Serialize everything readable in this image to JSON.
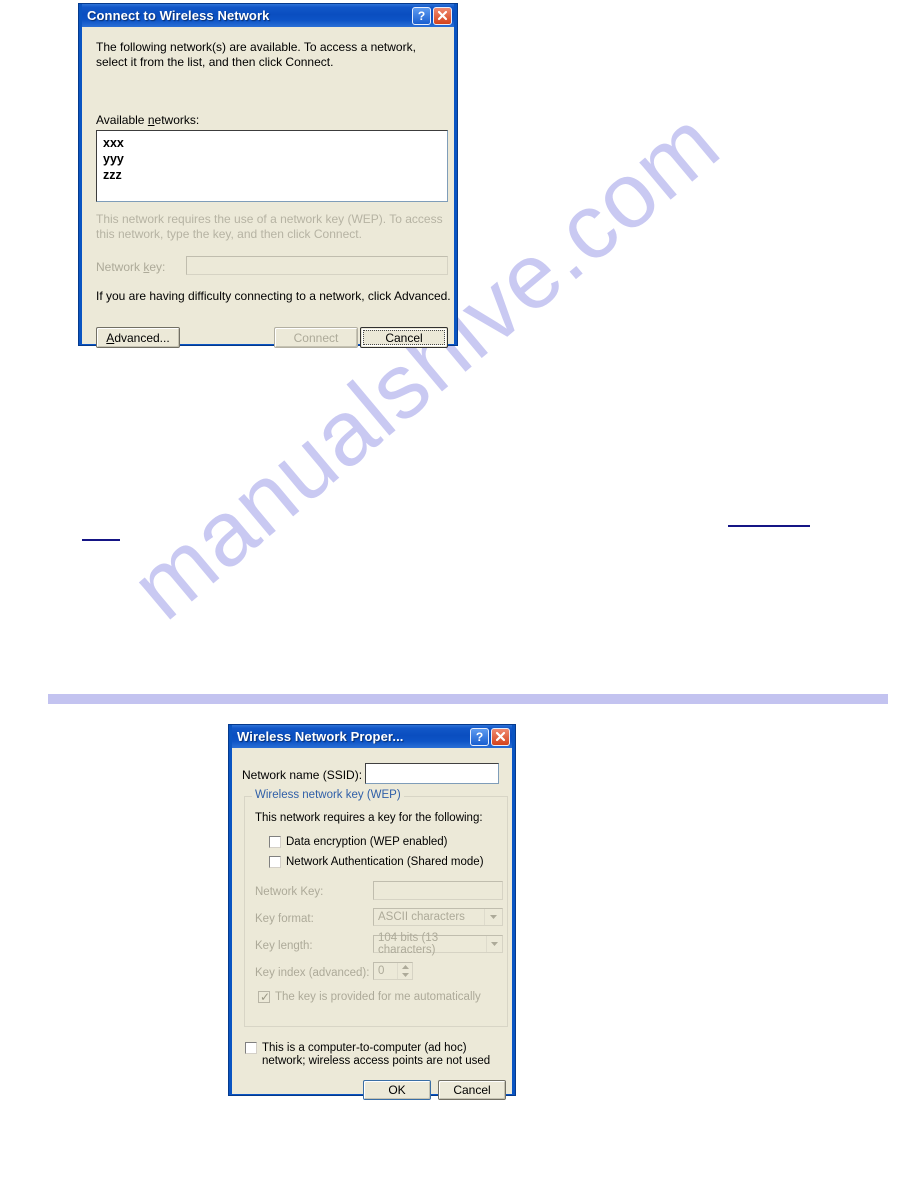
{
  "page": {
    "watermark_text": "manualshive.com",
    "watermark_color": "#c9c9f2",
    "band_color": "#c3c3f0",
    "link_color": "#151585"
  },
  "connect_dialog": {
    "title": "Connect to Wireless Network",
    "help_button": "?",
    "close_button": "close-icon",
    "intro_text": "The following network(s) are available. To access a network, select it from the list, and then click Connect.",
    "available_label": "Available networks:",
    "networks": [
      "xxx",
      "yyy",
      "zzz"
    ],
    "wep_note": "This network requires the use of a network key (WEP). To access this network, type the key, and then click Connect.",
    "network_key_label": "Network key:",
    "network_key_value": "",
    "help_note": "If you are having difficulty connecting to a network, click Advanced.",
    "buttons": {
      "advanced": "Advanced...",
      "connect": "Connect",
      "cancel": "Cancel"
    }
  },
  "properties_dialog": {
    "title": "Wireless Network Proper...",
    "help_button": "?",
    "close_button": "close-icon",
    "ssid_label": "Network name (SSID):",
    "ssid_value": "",
    "wep_group_title": "Wireless network key (WEP)",
    "requires_note": "This network requires a key for the following:",
    "data_encryption_label": "Data encryption (WEP enabled)",
    "network_auth_label": "Network Authentication (Shared mode)",
    "network_key_label": "Network Key:",
    "network_key_value": "",
    "key_format_label": "Key format:",
    "key_format_value": "ASCII characters",
    "key_length_label": "Key length:",
    "key_length_value": "104 bits (13 characters)",
    "key_index_label": "Key index (advanced):",
    "key_index_value": "0",
    "auto_key_label": "The key is provided for me automatically",
    "adhoc_label": "This is a computer-to-computer (ad hoc) network; wireless access points are not used",
    "buttons": {
      "ok": "OK",
      "cancel": "Cancel"
    }
  }
}
